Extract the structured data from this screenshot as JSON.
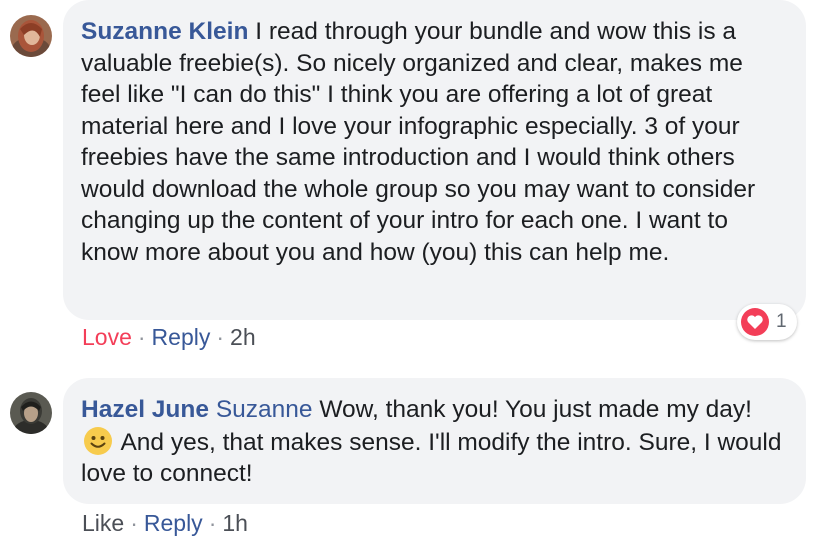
{
  "comments": [
    {
      "author": "Suzanne Klein",
      "text": " I read through your bundle and wow this is a valuable freebie(s). So nicely organized and clear, makes me feel like \"I can do this\" I think you are offering a lot of great material here and I love your infographic especially. 3 of your freebies have the same introduction and I would think others would download the whole group so you may want to consider changing up the content of your intro for each one. I want to know more about you and how (you) this can help me.",
      "actions": {
        "reaction_label": "Love",
        "reply_label": "Reply",
        "separator": "·",
        "time": "2h"
      },
      "reaction": {
        "icon": "heart-icon",
        "count": "1",
        "color": "#f33e58"
      }
    },
    {
      "author": "Hazel June",
      "mention": "Suzanne",
      "text_before_emoji": " Wow, thank you! You just made my day! ",
      "emoji": "smiley-emoji-icon",
      "text_after_emoji": " And yes, that makes sense. I'll modify the intro. Sure, I would love to connect!",
      "actions": {
        "reaction_label": "Like",
        "reply_label": "Reply",
        "separator": "·",
        "time": "1h"
      }
    }
  ],
  "colors": {
    "name_link": "#385898",
    "bubble": "#f2f3f5",
    "love": "#f33e58",
    "meta": "#606770"
  }
}
